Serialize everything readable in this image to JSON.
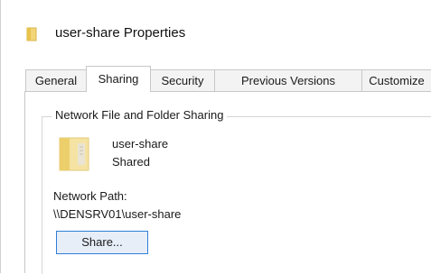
{
  "window": {
    "title": "user-share Properties",
    "title_icon": "folder-icon"
  },
  "tabs": [
    {
      "label": "General",
      "active": false
    },
    {
      "label": "Sharing",
      "active": true
    },
    {
      "label": "Security",
      "active": false
    },
    {
      "label": "Previous Versions",
      "active": false
    },
    {
      "label": "Customize",
      "active": false
    }
  ],
  "sharing": {
    "group_title": "Network File and Folder Sharing",
    "folder_icon": "folder-icon",
    "share_name": "user-share",
    "share_status": "Shared",
    "network_path_label": "Network Path:",
    "network_path_value": "\\\\DENSRV01\\user-share",
    "share_button_label": "Share..."
  },
  "colors": {
    "folder_yellow": "#e8c34a",
    "button_border": "#2f7fd6",
    "button_fill": "#e7eef8"
  }
}
